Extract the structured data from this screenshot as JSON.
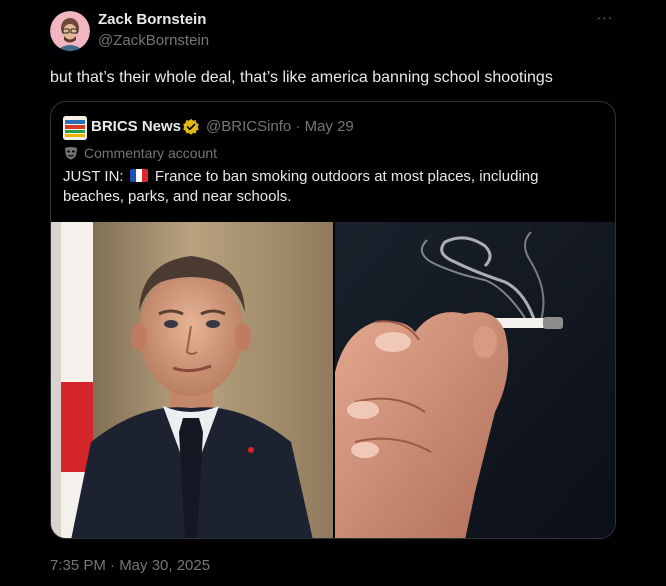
{
  "author": {
    "name": "Zack Bornstein",
    "handle": "@ZackBornstein"
  },
  "tweet": {
    "text": "but that’s their whole deal, that’s like america banning school shootings",
    "timestamp": "7:35 PM · May 30, 2025"
  },
  "more_menu": {
    "icon": "more-horizontal-icon",
    "glyph": "···"
  },
  "quote": {
    "name": "BRICS News",
    "handle_and_date": "@BRICSinfo · May 29",
    "label": "Commentary account",
    "text_prefix": "JUST IN:",
    "flag": "france-flag",
    "text_body": "France to ban smoking outdoors at most places, including beaches, parks, and near schools.",
    "badge_color": "#e2b719",
    "media": [
      {
        "name": "macron-photo"
      },
      {
        "name": "cigarette-hand-photo"
      }
    ]
  },
  "colors": {
    "background": "#000000",
    "text_primary": "#e7e9ea",
    "text_secondary": "#71767b",
    "border": "#2f3336"
  }
}
